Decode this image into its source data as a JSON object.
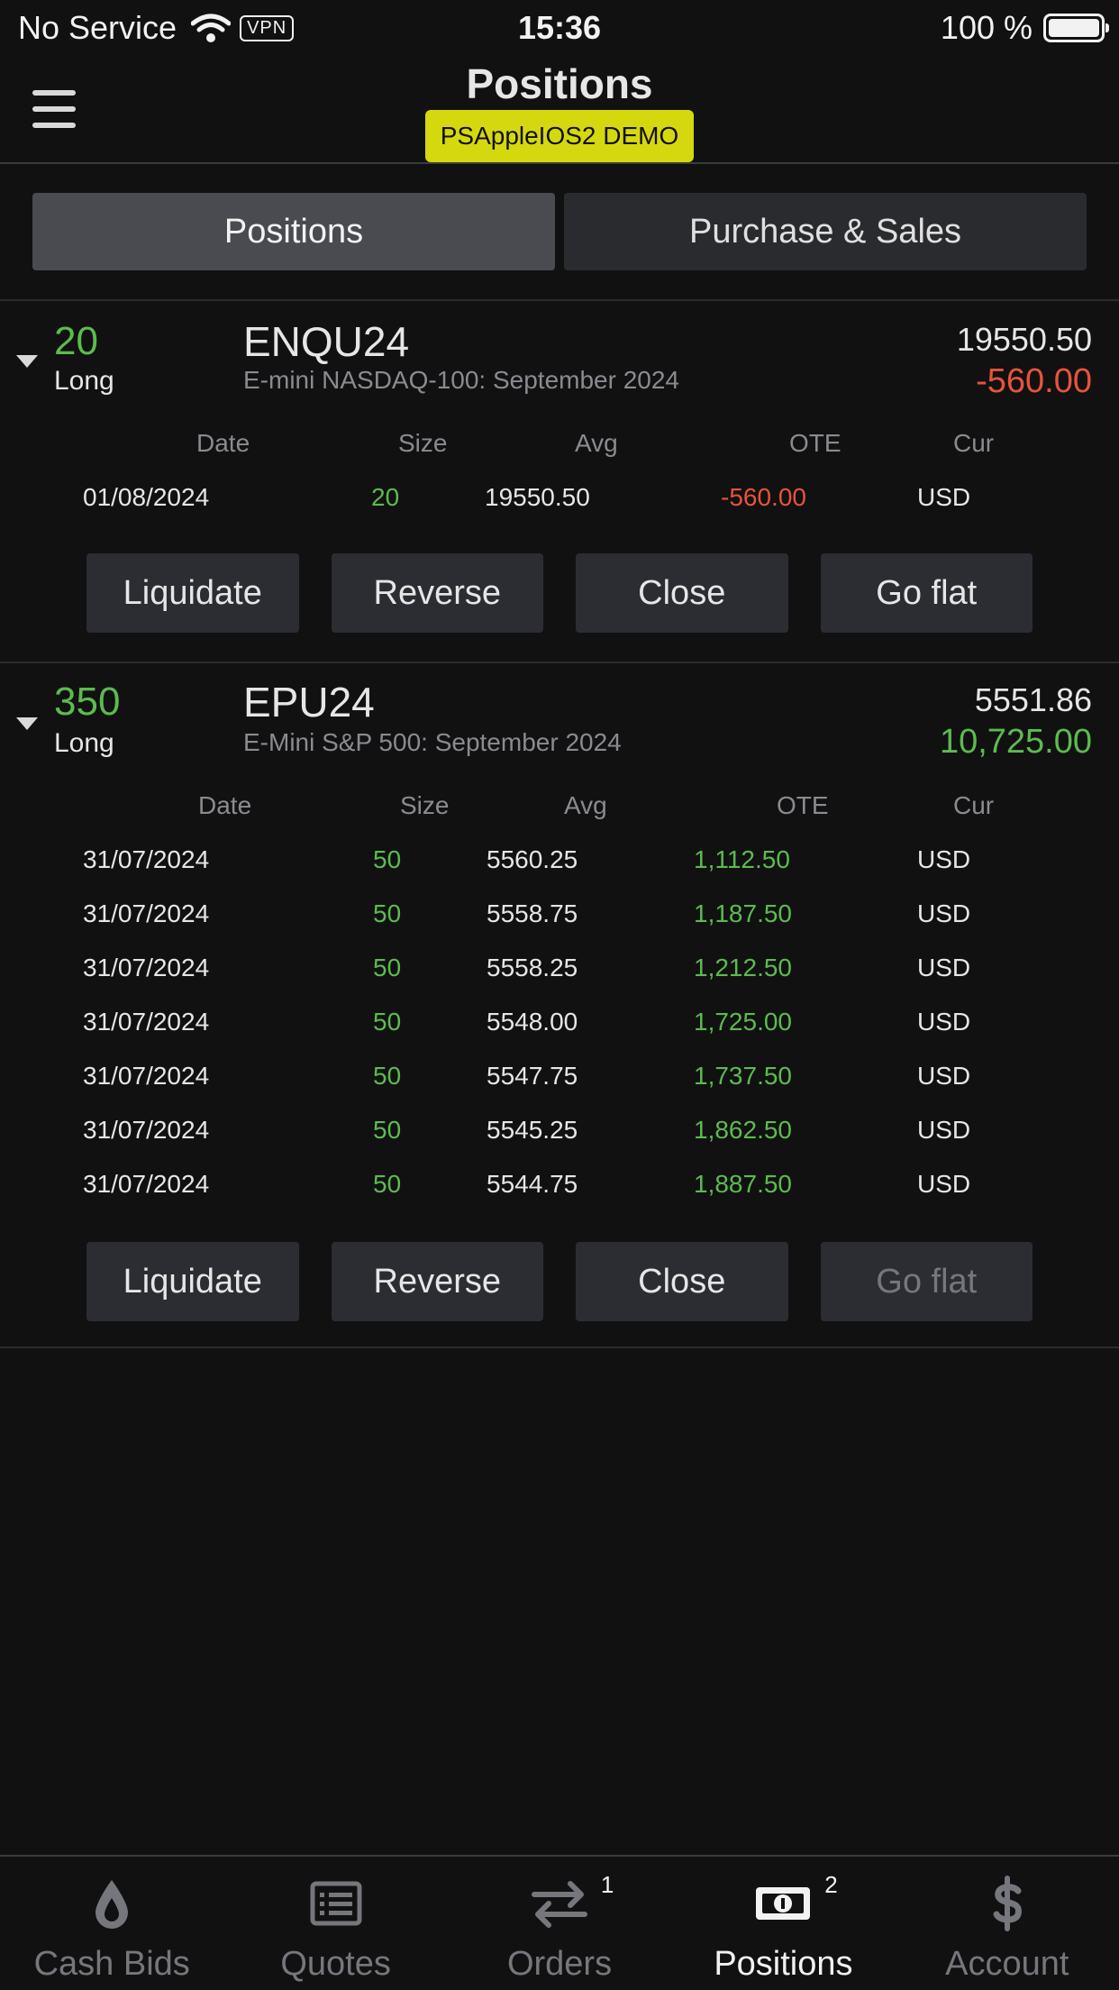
{
  "status_bar": {
    "carrier": "No Service",
    "vpn": "VPN",
    "time": "15:36",
    "battery": "100 %"
  },
  "header": {
    "title": "Positions",
    "account": "PSAppleIOS2 DEMO"
  },
  "tabs": [
    {
      "label": "Positions",
      "active": true
    },
    {
      "label": "Purchase & Sales",
      "active": false
    }
  ],
  "columns": {
    "date": "Date",
    "size": "Size",
    "avg": "Avg",
    "ote": "OTE",
    "cur": "Cur"
  },
  "positions": [
    {
      "qty": "20",
      "side": "Long",
      "symbol": "ENQU24",
      "description": "E-mini NASDAQ-100: September 2024",
      "price": "19550.50",
      "pnl": "-560.00",
      "pnl_sign": "negative",
      "fills": [
        {
          "date": "01/08/2024",
          "size": "20",
          "avg": "19550.50",
          "ote": "-560.00",
          "cur": "USD"
        }
      ],
      "actions": {
        "liquidate": "Liquidate",
        "reverse": "Reverse",
        "close": "Close",
        "go_flat": "Go flat"
      }
    },
    {
      "qty": "350",
      "side": "Long",
      "symbol": "EPU24",
      "description": "E-Mini S&P 500: September 2024",
      "price": "5551.86",
      "pnl": "10,725.00",
      "pnl_sign": "positive",
      "fills": [
        {
          "date": "31/07/2024",
          "size": "50",
          "avg": "5560.25",
          "ote": "1,112.50",
          "cur": "USD"
        },
        {
          "date": "31/07/2024",
          "size": "50",
          "avg": "5558.75",
          "ote": "1,187.50",
          "cur": "USD"
        },
        {
          "date": "31/07/2024",
          "size": "50",
          "avg": "5558.25",
          "ote": "1,212.50",
          "cur": "USD"
        },
        {
          "date": "31/07/2024",
          "size": "50",
          "avg": "5548.00",
          "ote": "1,725.00",
          "cur": "USD"
        },
        {
          "date": "31/07/2024",
          "size": "50",
          "avg": "5547.75",
          "ote": "1,737.50",
          "cur": "USD"
        },
        {
          "date": "31/07/2024",
          "size": "50",
          "avg": "5545.25",
          "ote": "1,862.50",
          "cur": "USD"
        },
        {
          "date": "31/07/2024",
          "size": "50",
          "avg": "5544.75",
          "ote": "1,887.50",
          "cur": "USD"
        }
      ],
      "actions": {
        "liquidate": "Liquidate",
        "reverse": "Reverse",
        "close": "Close",
        "go_flat": "Go flat"
      }
    }
  ],
  "tabbar": [
    {
      "label": "Cash Bids",
      "icon": "drop-icon",
      "active": false,
      "count": ""
    },
    {
      "label": "Quotes",
      "icon": "list-icon",
      "active": false,
      "count": ""
    },
    {
      "label": "Orders",
      "icon": "swap-arrows-icon",
      "active": false,
      "count": "1"
    },
    {
      "label": "Positions",
      "icon": "cash-icon",
      "active": true,
      "count": "2"
    },
    {
      "label": "Account",
      "icon": "dollar-icon",
      "active": false,
      "count": ""
    }
  ],
  "colors": {
    "positive": "#5cbb4e",
    "negative": "#e8533a",
    "badge": "#d6d80f",
    "background": "#111112"
  }
}
